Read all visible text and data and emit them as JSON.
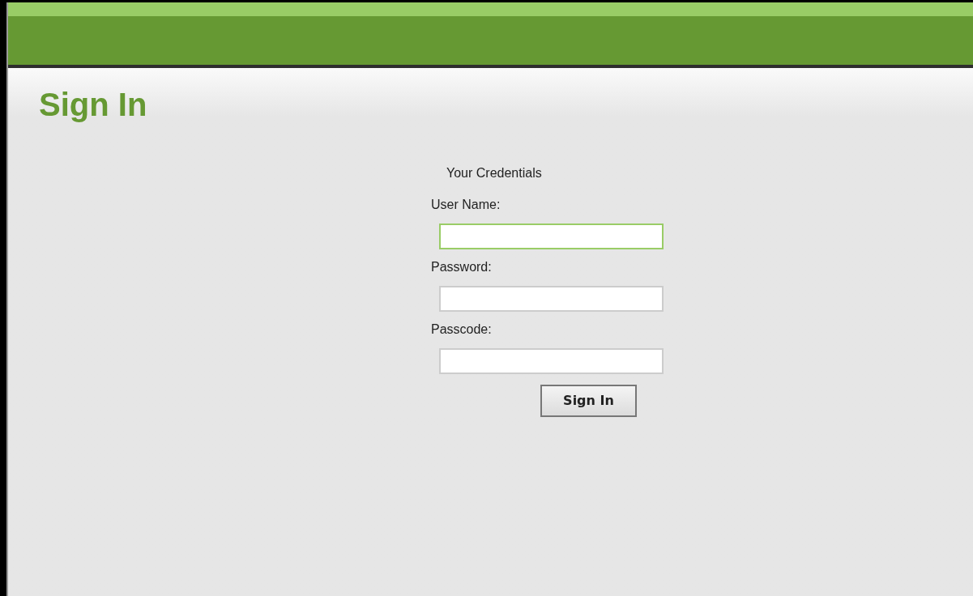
{
  "page": {
    "title": "Sign In"
  },
  "form": {
    "heading": "Your Credentials",
    "fields": [
      {
        "label": "User Name:",
        "focused": true
      },
      {
        "label": "Password:",
        "focused": false
      },
      {
        "label": "Passcode:",
        "focused": false
      }
    ],
    "submit": "Sign In"
  }
}
